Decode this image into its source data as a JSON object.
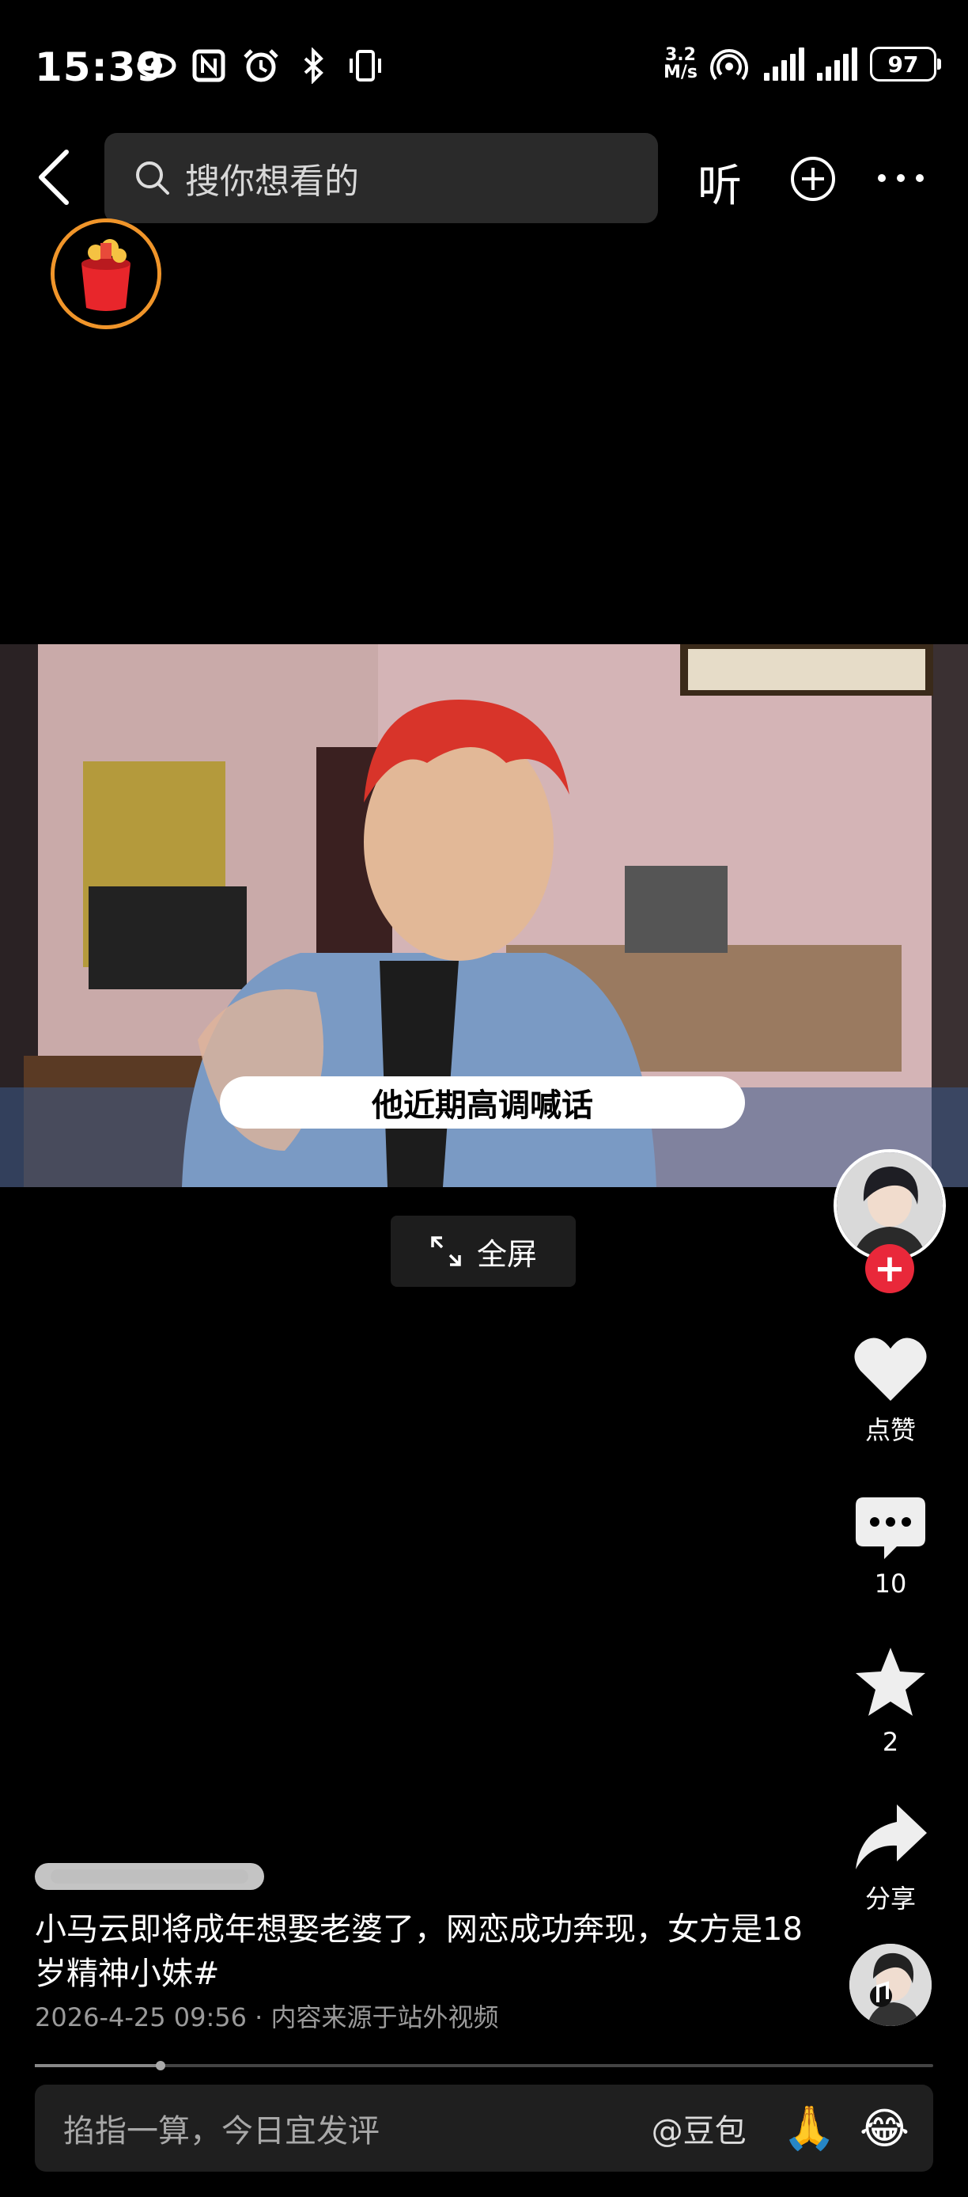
{
  "status": {
    "time": "15:39",
    "net_speed_value": "3.2",
    "net_speed_unit": "M/s",
    "battery": "97",
    "icons": [
      "eye-icon",
      "nfc-icon",
      "alarm-icon",
      "bluetooth-icon",
      "vibrate-icon",
      "hotspot-icon",
      "signal-icon",
      "signal-icon",
      "battery-icon"
    ]
  },
  "nav": {
    "search_placeholder": "搜你想看的",
    "listen_label": "听"
  },
  "video": {
    "subtitle": "他近期高调喊话",
    "fullscreen_label": "全屏"
  },
  "rail": {
    "like_label": "点赞",
    "comment_count": "10",
    "favorite_count": "2",
    "share_label": "分享"
  },
  "post": {
    "description": "小马云即将成年想娶老婆了，网恋成功奔现，女方是18岁精神小妹#",
    "meta": "2026-4-25 09:56 · 内容来源于站外视频",
    "progress": 0.14
  },
  "comment_bar": {
    "placeholder": "掐指一算，今日宜发评",
    "mention": "@豆包",
    "emoji_1": "🙏",
    "emoji_2": "😂"
  }
}
